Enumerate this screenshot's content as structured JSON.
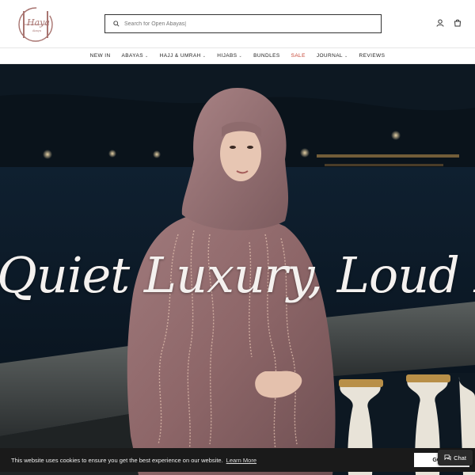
{
  "brand": {
    "logo_text": "Haya",
    "logo_subtext": "Abaya",
    "logo_color": "#a87470"
  },
  "search": {
    "placeholder": "Search for Open Abayas|",
    "icon": "search-icon"
  },
  "header_icons": [
    "account-icon",
    "cart-icon"
  ],
  "nav": {
    "items": [
      {
        "label": "NEW IN",
        "has_dropdown": false,
        "sale": false
      },
      {
        "label": "ABAYAS",
        "has_dropdown": true,
        "sale": false
      },
      {
        "label": "HAJJ & UMRAH",
        "has_dropdown": true,
        "sale": false
      },
      {
        "label": "HIJABS",
        "has_dropdown": true,
        "sale": false
      },
      {
        "label": "BUNDLES",
        "has_dropdown": false,
        "sale": false
      },
      {
        "label": "SALE",
        "has_dropdown": false,
        "sale": true
      },
      {
        "label": "JOURNAL",
        "has_dropdown": true,
        "sale": false
      },
      {
        "label": "REVIEWS",
        "has_dropdown": false,
        "sale": false
      }
    ],
    "sale_color": "#c4402f"
  },
  "hero": {
    "headline": "Quiet Luxury, Loud Presence"
  },
  "cookie": {
    "message": "This website uses cookies to ensure you get the best experience on our website.",
    "learn_more": "Learn More",
    "accept": "GOT IT"
  },
  "chat": {
    "label": "Chat",
    "icon": "chat-icon"
  }
}
